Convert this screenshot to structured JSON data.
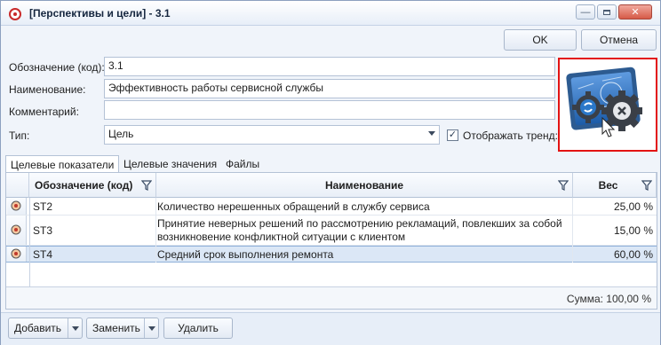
{
  "window": {
    "title": "[Перспективы и цели] - 3.1",
    "minimize_glyph": "—",
    "close_glyph": "✕"
  },
  "toolbar": {
    "ok_label": "OK",
    "cancel_label": "Отмена"
  },
  "form": {
    "code_label": "Обозначение (код):",
    "code_value": "3.1",
    "name_label": "Наименование:",
    "name_value": "Эффективность работы сервисной службы",
    "comment_label": "Комментарий:",
    "comment_value": "",
    "type_label": "Тип:",
    "type_value": "Цель",
    "show_trend_label": "Отображать тренд:",
    "show_trend_checked": true,
    "check_mark": "✓"
  },
  "tabs": [
    {
      "label": "Целевые показатели",
      "active": true
    },
    {
      "label": "Целевые значения",
      "active": false
    },
    {
      "label": "Файлы",
      "active": false
    }
  ],
  "grid": {
    "columns": [
      {
        "label": "Обозначение (код)"
      },
      {
        "label": "Наименование"
      },
      {
        "label": "Вес"
      }
    ],
    "rows": [
      {
        "code": "ST2",
        "name": "Количество нерешенных обращений в службу сервиса",
        "name2": "",
        "weight": "25,00 %",
        "selected": false
      },
      {
        "code": "ST3",
        "name": "Принятие неверных решений по рассмотрению рекламаций, повлекших за собой",
        "name2": "возникновение конфликтной ситуации с клиентом",
        "weight": "15,00 %",
        "selected": false
      },
      {
        "code": "ST4",
        "name": "Средний срок выполнения ремонта",
        "name2": "",
        "weight": "60,00 %",
        "selected": true
      }
    ],
    "summary": "Сумма: 100,00 %"
  },
  "bottom": {
    "add_label": "Добавить",
    "replace_label": "Заменить",
    "delete_label": "Удалить"
  },
  "colors": {
    "accent": "#e31313",
    "selection": "#dbe7f6"
  }
}
